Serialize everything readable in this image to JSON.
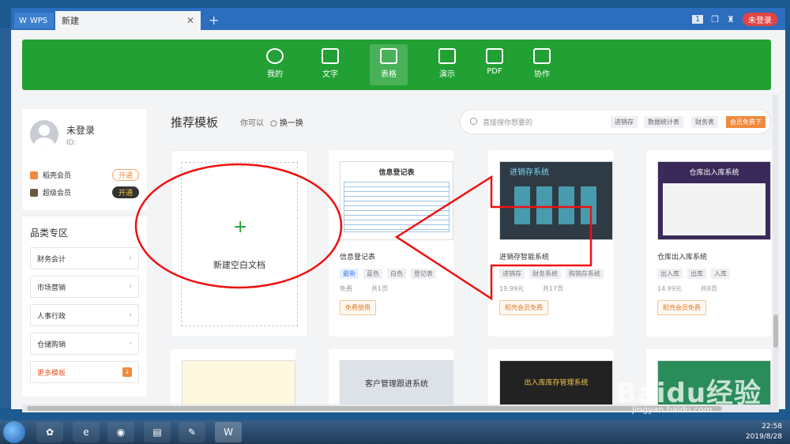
{
  "titlebar": {
    "wps_tab": "WPS",
    "doc_tab": "新建",
    "counter": "1",
    "login": "未登录"
  },
  "ribbon": {
    "items": [
      {
        "label": "我的",
        "icon": "star-icon"
      },
      {
        "label": "文字",
        "icon": "doc-icon"
      },
      {
        "label": "表格",
        "icon": "table-icon"
      },
      {
        "label": "演示",
        "icon": "slides-icon"
      },
      {
        "label": "PDF",
        "icon": "pdf-icon"
      },
      {
        "label": "协作",
        "icon": "collab-icon"
      }
    ],
    "active": "表格"
  },
  "user": {
    "name": "未登录",
    "id": "ID:"
  },
  "vip": [
    {
      "label": "稻壳会员",
      "btn": "开通"
    },
    {
      "label": "超级会员",
      "btn": "开通"
    }
  ],
  "categories": {
    "title": "品类专区",
    "items": [
      "财务会计",
      "市场营销",
      "人事行政",
      "仓储购销",
      "更多模板"
    ]
  },
  "main": {
    "title": "推荐模板",
    "hint": "你可以",
    "swap": "换一换"
  },
  "search": {
    "placeholder": "直接搜你想要的",
    "chips": [
      "进销存",
      "数据统计表",
      "财务表",
      "会员免费下"
    ]
  },
  "blank": {
    "label": "新建空白文档",
    "plus": "+"
  },
  "templates": [
    {
      "name": "信息登记表",
      "thumb": "信息登记表",
      "tags": [
        "最新",
        "蓝色",
        "白色",
        "登记表"
      ],
      "price": "免费",
      "pages": "共1页",
      "action": "免费使用"
    },
    {
      "name": "进销存智能系统",
      "thumb": "进销存系统",
      "tags": [
        "进销存",
        "财务系统",
        "购销存系统"
      ],
      "price": "19.99元",
      "pages": "共17页",
      "action": "稻壳会员免费"
    },
    {
      "name": "仓库出入库系统",
      "thumb": "仓库出入库系统",
      "tags": [
        "出入库",
        "出库",
        "入库"
      ],
      "price": "14.99元",
      "pages": "共8页",
      "action": "稻壳会员免费"
    }
  ],
  "row2": [
    "客户管理跟进系统",
    "出入库库存管理系统"
  ],
  "taskbar": {
    "time": "22:58",
    "date": "2019/8/28"
  },
  "watermark": {
    "text": "Baidu经验",
    "url": "jingyan.baidu.com"
  }
}
